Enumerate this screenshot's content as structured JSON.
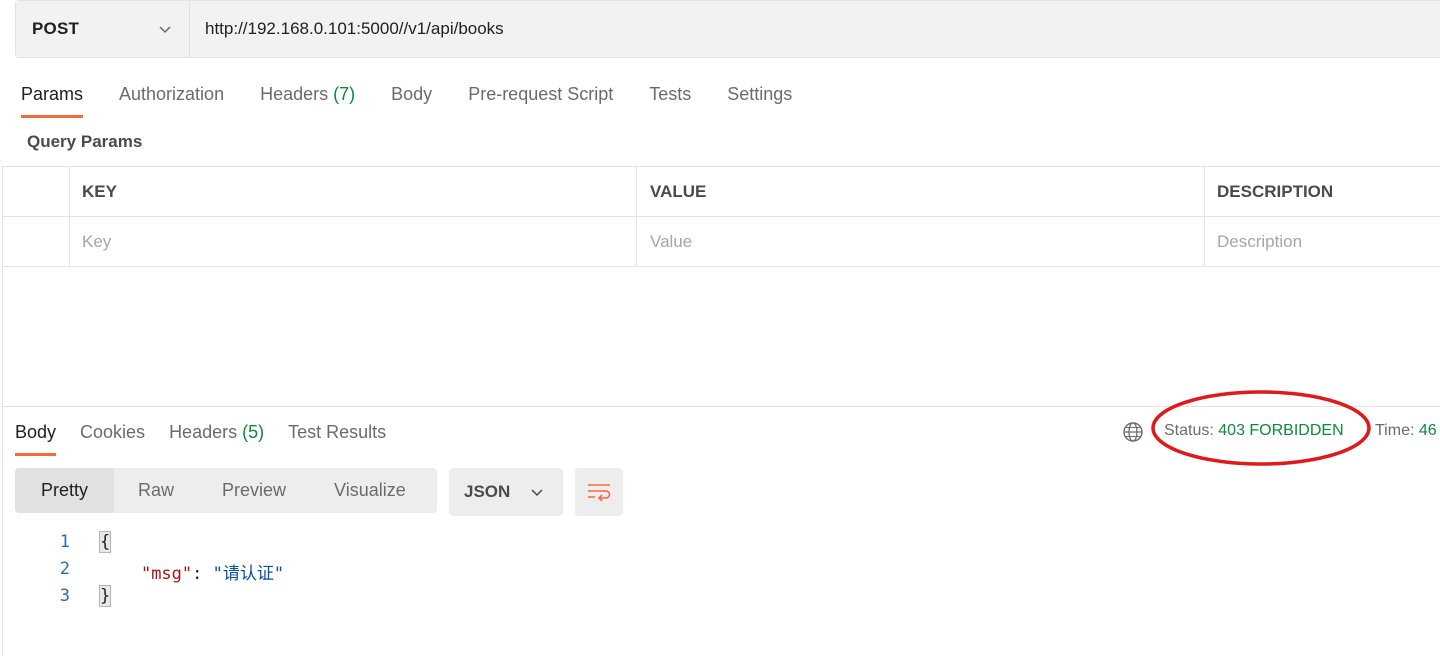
{
  "request": {
    "method": "POST",
    "url": "http://192.168.0.101:5000//v1/api/books"
  },
  "request_tabs": [
    {
      "label": "Params",
      "active": true
    },
    {
      "label": "Authorization"
    },
    {
      "label": "Headers",
      "count": "(7)"
    },
    {
      "label": "Body"
    },
    {
      "label": "Pre-request Script"
    },
    {
      "label": "Tests"
    },
    {
      "label": "Settings"
    }
  ],
  "query_params": {
    "title": "Query Params",
    "columns": [
      "KEY",
      "VALUE",
      "DESCRIPTION"
    ],
    "placeholders": [
      "Key",
      "Value",
      "Description"
    ]
  },
  "response_tabs": [
    {
      "label": "Body",
      "active": true
    },
    {
      "label": "Cookies"
    },
    {
      "label": "Headers",
      "count": "(5)"
    },
    {
      "label": "Test Results"
    }
  ],
  "response_meta": {
    "status_label": "Status:",
    "status_value": "403 FORBIDDEN",
    "time_label": "Time:",
    "time_value": "46",
    "highlight_color": "#e0191b"
  },
  "format_tabs": [
    "Pretty",
    "Raw",
    "Preview",
    "Visualize"
  ],
  "language": "JSON",
  "code_lines": [
    {
      "num": "1",
      "open": "{"
    },
    {
      "num": "2",
      "key": "\"msg\"",
      "sep": ": ",
      "value": "\"请认证\""
    },
    {
      "num": "3",
      "close": "}"
    }
  ],
  "colors": {
    "accent": "#f26b3a",
    "success": "#0c8a3e"
  }
}
